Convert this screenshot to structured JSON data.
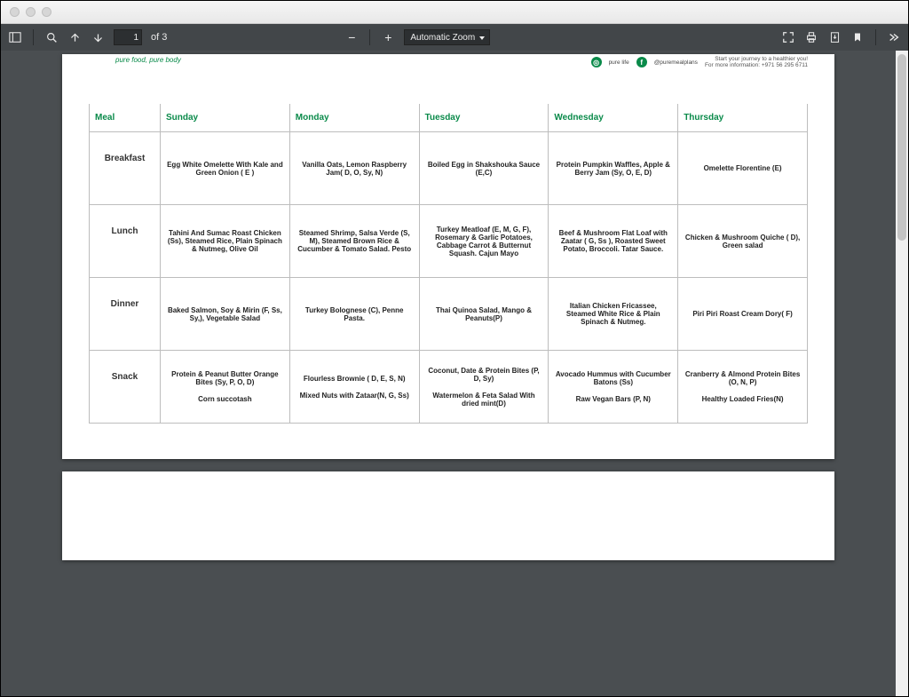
{
  "titlebar": {},
  "toolbar": {
    "page_current": "1",
    "page_label_of": "of 3",
    "zoom_label": "Automatic Zoom"
  },
  "doc": {
    "tagline": "pure food, pure body",
    "social1_label": "pure life",
    "social2_label": "@puremealplans",
    "contact_line1": "Start your journey to a healthier you!",
    "contact_line2": "For more information: +971 56 295 6711"
  },
  "table": {
    "headers": [
      "Meal",
      "Sunday",
      "Monday",
      "Tuesday",
      "Wednesday",
      "Thursday"
    ],
    "rows": [
      {
        "label": "Breakfast",
        "cells": [
          [
            "Egg White Omelette With Kale and Green Onion ( E )"
          ],
          [
            "Vanilla Oats, Lemon Raspberry Jam( D, O, Sy, N)"
          ],
          [
            "Boiled  Egg in Shakshouka Sauce (E,C)"
          ],
          [
            "Protein Pumpkin Waffles, Apple & Berry Jam (Sy, O, E, D)"
          ],
          [
            "Omelette Florentine (E)"
          ]
        ]
      },
      {
        "label": "Lunch",
        "cells": [
          [
            "Tahini And Sumac Roast Chicken (Ss), Steamed Rice, Plain Spinach & Nutmeg, Olive Oil"
          ],
          [
            "Steamed Shrimp, Salsa Verde (S, M), Steamed Brown Rice & Cucumber & Tomato Salad. Pesto"
          ],
          [
            "Turkey Meatloaf (E, M, G, F), Rosemary & Garlic Potatoes, Cabbage Carrot & Butternut Squash. Cajun Mayo"
          ],
          [
            "Beef & Mushroom Flat Loaf with Zaatar ( G, Ss ), Roasted Sweet Potato, Broccoli. Tatar Sauce."
          ],
          [
            "Chicken & Mushroom Quiche ( D), Green salad"
          ]
        ]
      },
      {
        "label": "Dinner",
        "cells": [
          [
            "Baked Salmon, Soy & Mirin (F, Ss, Sy,), Vegetable Salad"
          ],
          [
            "Turkey Bolognese (C), Penne Pasta."
          ],
          [
            "Thai Quinoa Salad, Mango & Peanuts(P)"
          ],
          [
            "Italian Chicken Fricassee, Steamed White Rice & Plain Spinach & Nutmeg."
          ],
          [
            "Piri Piri Roast Cream Dory( F)"
          ]
        ]
      },
      {
        "label": "Snack",
        "cells": [
          [
            "Protein & Peanut Butter Orange Bites (Sy, P, O, D)",
            "Corn succotash"
          ],
          [
            "Flourless  Brownie ( D, E, S, N)",
            "Mixed Nuts with Zataar(N, G, Ss)"
          ],
          [
            "Coconut, Date & Protein Bites (P, D, Sy)",
            "Watermelon & Feta Salad With dried mint(D)"
          ],
          [
            "Avocado Hummus with Cucumber Batons (Ss)",
            "Raw Vegan Bars (P, N)"
          ],
          [
            "Cranberry & Almond Protein Bites (O, N, P)",
            "Healthy Loaded Fries(N)"
          ]
        ]
      }
    ]
  }
}
